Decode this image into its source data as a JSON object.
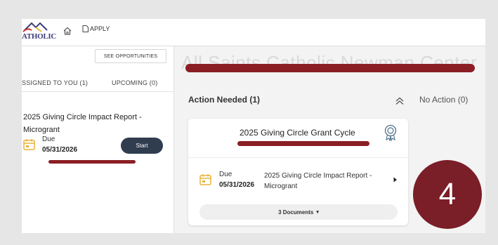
{
  "header": {
    "logo_text": "ATHOLIC",
    "home_icon": "home-icon",
    "apply_label": "APPLY"
  },
  "sidebar": {
    "see_opportunities_label": "SEE OPPORTUNITIES",
    "tabs": [
      {
        "label": "SSIGNED TO YOU (1)"
      },
      {
        "label": "UPCOMING (0)"
      }
    ],
    "task": {
      "title": "2025 Giving Circle Impact Report - Microgrant",
      "due_label": "Due",
      "due_date": "05/31/2026",
      "start_label": "Start"
    }
  },
  "main": {
    "org_title": "All Saints Catholic Newman Center",
    "action_needed_label": "Action Needed (1)",
    "no_action_label": "No Action (0)",
    "card": {
      "title": "2025 Giving Circle Grant Cycle",
      "due_label": "Due",
      "due_date": "05/31/2026",
      "task_desc": "2025 Giving Circle Impact Report - Microgrant",
      "documents_label": "3 Documents"
    }
  },
  "step_badge": "4",
  "colors": {
    "redaction": "#8b1e24",
    "badge": "#7a1e27",
    "start_button": "#2f3d4f",
    "calendar_icon": "#e8b43a"
  }
}
